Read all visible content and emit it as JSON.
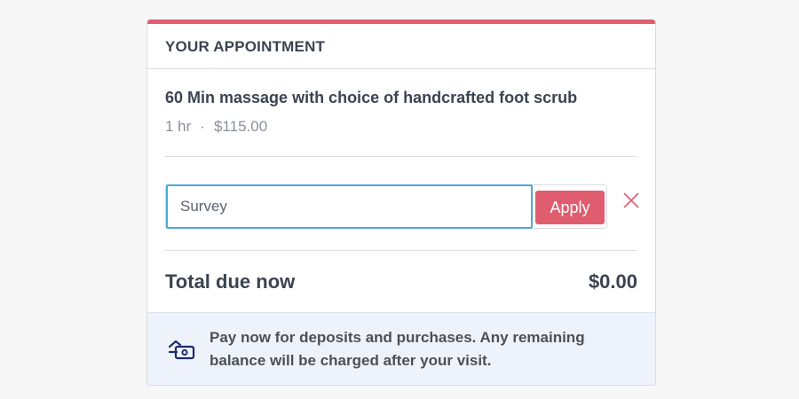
{
  "colors": {
    "accent": "#e05d6f",
    "focus_border": "#4aa9d8",
    "notice_bg": "#eef3fb",
    "notice_icon": "#1d2b6b"
  },
  "appointment": {
    "header": "YOUR APPOINTMENT",
    "service_name": "60 Min massage with choice of handcrafted foot scrub",
    "duration": "1 hr",
    "separator": "·",
    "price": "$115.00"
  },
  "promo": {
    "value": "Survey",
    "apply_label": "Apply",
    "close_icon": "close-icon"
  },
  "total": {
    "label": "Total due now",
    "amount": "$0.00"
  },
  "notice": {
    "icon": "payment-icon",
    "text": "Pay now for deposits and purchases. Any remaining balance will be charged after your visit."
  }
}
